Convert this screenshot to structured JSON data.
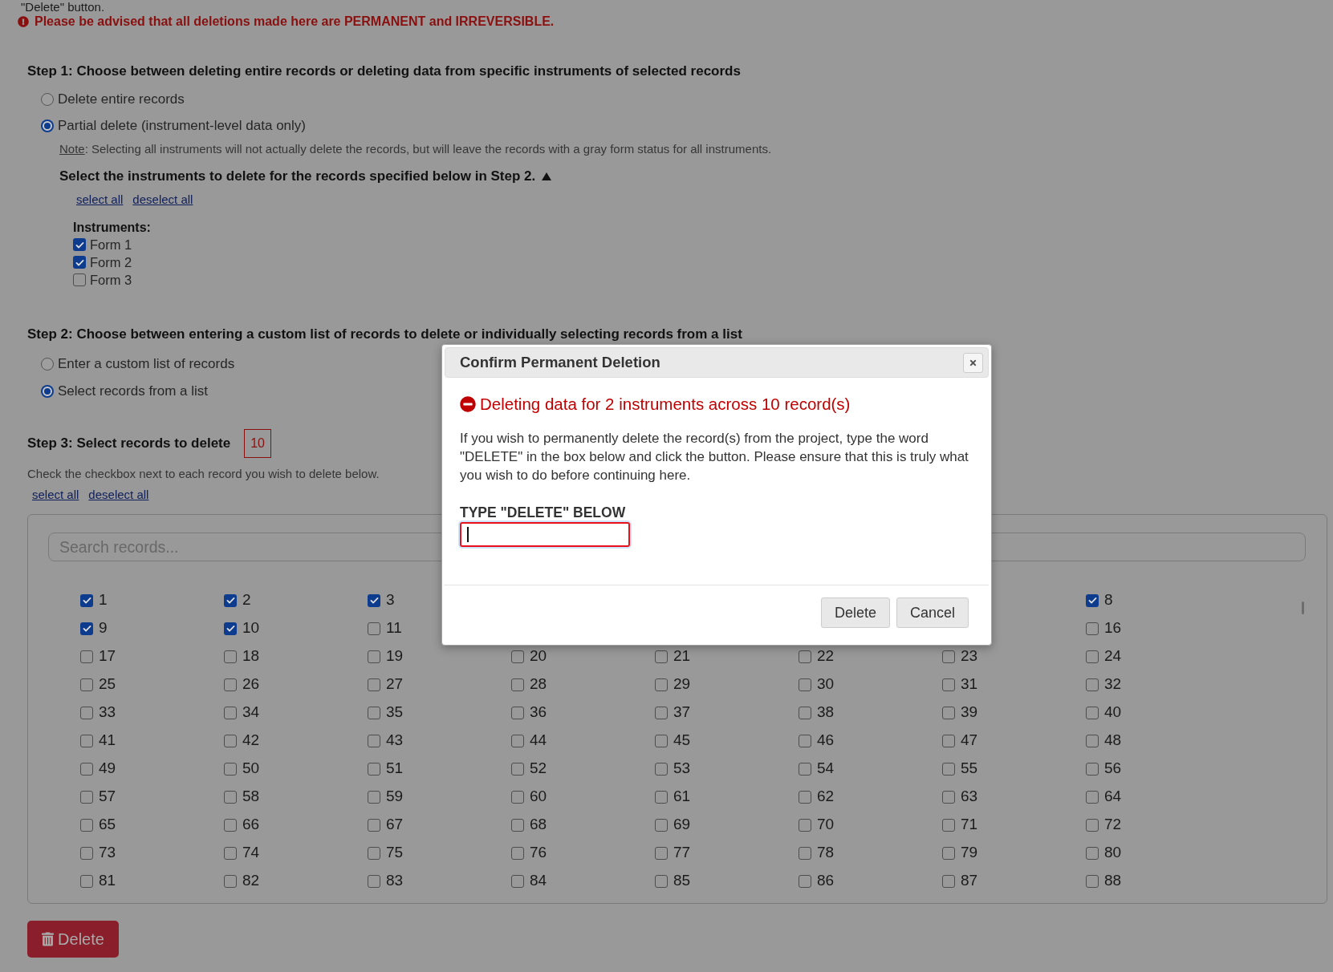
{
  "intro_tail": "\"Delete\" button.",
  "warning": {
    "text": "Please be advised that all deletions made here are PERMANENT and IRREVERSIBLE."
  },
  "step1": {
    "heading": "Step 1: Choose between deleting entire records or deleting data from specific instruments of selected records",
    "options": [
      {
        "label": "Delete entire records",
        "selected": false
      },
      {
        "label": "Partial delete (instrument-level data only)",
        "selected": true
      }
    ],
    "note_label": "Note",
    "note_text": ": Selecting all instruments will not actually delete the records, but will leave the records with a gray form status for all instruments.",
    "instruments_heading": "Select the instruments to delete for the records specified below in Step 2.",
    "expanded": true,
    "links": [
      "select all",
      "deselect all"
    ],
    "instruments_label": "Instruments:",
    "instruments": [
      {
        "label": "Form 1",
        "checked": true
      },
      {
        "label": "Form 2",
        "checked": true
      },
      {
        "label": "Form 3",
        "checked": false
      }
    ]
  },
  "step2": {
    "heading": "Step 2: Choose between entering a custom list of records to delete or individually selecting records from a list",
    "options": [
      {
        "label": "Enter a custom list of records",
        "selected": false
      },
      {
        "label": "Select records from a list",
        "selected": true
      }
    ]
  },
  "step3": {
    "heading": "Step 3: Select records to delete",
    "count": "10",
    "hint": "Check the checkbox next to each record you wish to delete below.",
    "links": [
      "select all",
      "deselect all"
    ],
    "search": {
      "placeholder": "Search records..."
    },
    "rows": [
      {
        "cells": [
          {
            "label": "1",
            "checked": true
          },
          {
            "label": "2",
            "checked": true
          },
          {
            "label": "3",
            "checked": true
          },
          null,
          null,
          null,
          null,
          {
            "label": "8",
            "checked": true
          }
        ]
      },
      {
        "cells": [
          {
            "label": "9",
            "checked": true
          },
          {
            "label": "10",
            "checked": true
          },
          {
            "label": "11",
            "checked": false
          },
          null,
          null,
          null,
          null,
          {
            "label": "16",
            "checked": false
          }
        ]
      },
      {
        "cells": [
          {
            "label": "17",
            "checked": false
          },
          {
            "label": "18",
            "checked": false
          },
          {
            "label": "19",
            "checked": false
          },
          {
            "label": "20",
            "checked": false
          },
          {
            "label": "21",
            "checked": false
          },
          {
            "label": "22",
            "checked": false
          },
          {
            "label": "23",
            "checked": false
          },
          {
            "label": "24",
            "checked": false
          }
        ]
      },
      {
        "cells": [
          {
            "label": "25",
            "checked": false
          },
          {
            "label": "26",
            "checked": false
          },
          {
            "label": "27",
            "checked": false
          },
          {
            "label": "28",
            "checked": false
          },
          {
            "label": "29",
            "checked": false
          },
          {
            "label": "30",
            "checked": false
          },
          {
            "label": "31",
            "checked": false
          },
          {
            "label": "32",
            "checked": false
          }
        ]
      },
      {
        "cells": [
          {
            "label": "33",
            "checked": false
          },
          {
            "label": "34",
            "checked": false
          },
          {
            "label": "35",
            "checked": false
          },
          {
            "label": "36",
            "checked": false
          },
          {
            "label": "37",
            "checked": false
          },
          {
            "label": "38",
            "checked": false
          },
          {
            "label": "39",
            "checked": false
          },
          {
            "label": "40",
            "checked": false
          }
        ]
      },
      {
        "cells": [
          {
            "label": "41",
            "checked": false
          },
          {
            "label": "42",
            "checked": false
          },
          {
            "label": "43",
            "checked": false
          },
          {
            "label": "44",
            "checked": false
          },
          {
            "label": "45",
            "checked": false
          },
          {
            "label": "46",
            "checked": false
          },
          {
            "label": "47",
            "checked": false
          },
          {
            "label": "48",
            "checked": false
          }
        ]
      },
      {
        "cells": [
          {
            "label": "49",
            "checked": false
          },
          {
            "label": "50",
            "checked": false
          },
          {
            "label": "51",
            "checked": false
          },
          {
            "label": "52",
            "checked": false
          },
          {
            "label": "53",
            "checked": false
          },
          {
            "label": "54",
            "checked": false
          },
          {
            "label": "55",
            "checked": false
          },
          {
            "label": "56",
            "checked": false
          }
        ]
      },
      {
        "cells": [
          {
            "label": "57",
            "checked": false
          },
          {
            "label": "58",
            "checked": false
          },
          {
            "label": "59",
            "checked": false
          },
          {
            "label": "60",
            "checked": false
          },
          {
            "label": "61",
            "checked": false
          },
          {
            "label": "62",
            "checked": false
          },
          {
            "label": "63",
            "checked": false
          },
          {
            "label": "64",
            "checked": false
          }
        ]
      },
      {
        "cells": [
          {
            "label": "65",
            "checked": false
          },
          {
            "label": "66",
            "checked": false
          },
          {
            "label": "67",
            "checked": false
          },
          {
            "label": "68",
            "checked": false
          },
          {
            "label": "69",
            "checked": false
          },
          {
            "label": "70",
            "checked": false
          },
          {
            "label": "71",
            "checked": false
          },
          {
            "label": "72",
            "checked": false
          }
        ]
      },
      {
        "cells": [
          {
            "label": "73",
            "checked": false
          },
          {
            "label": "74",
            "checked": false
          },
          {
            "label": "75",
            "checked": false
          },
          {
            "label": "76",
            "checked": false
          },
          {
            "label": "77",
            "checked": false
          },
          {
            "label": "78",
            "checked": false
          },
          {
            "label": "79",
            "checked": false
          },
          {
            "label": "80",
            "checked": false
          }
        ]
      },
      {
        "cells": [
          {
            "label": "81",
            "checked": false
          },
          {
            "label": "82",
            "checked": false
          },
          {
            "label": "83",
            "checked": false
          },
          {
            "label": "84",
            "checked": false
          },
          {
            "label": "85",
            "checked": false
          },
          {
            "label": "86",
            "checked": false
          },
          {
            "label": "87",
            "checked": false
          },
          {
            "label": "88",
            "checked": false
          }
        ]
      }
    ]
  },
  "delete_button": {
    "label": "Delete"
  },
  "modal": {
    "title": "Confirm Permanent Deletion",
    "alert": "Deleting data for 2 instruments across 10 record(s)",
    "message": "If you wish to permanently delete the record(s) from the project, type the word \"DELETE\" in the box below and click the button. Please ensure that this is truly what you wish to do before continuing here.",
    "field_label": "TYPE \"DELETE\" BELOW",
    "confirm_field": {
      "focused": true
    },
    "buttons": [
      "Delete",
      "Cancel"
    ]
  }
}
